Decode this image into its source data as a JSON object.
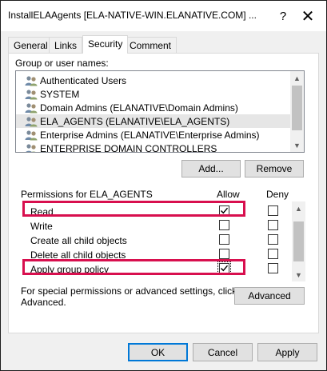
{
  "window": {
    "title": "InstallELAAgents [ELA-NATIVE-WIN.ELANATIVE.COM] ...",
    "help_glyph": "?",
    "close_glyph": "✕"
  },
  "tabs": [
    {
      "label": "General"
    },
    {
      "label": "Links"
    },
    {
      "label": "Security",
      "active": true
    },
    {
      "label": "Comment"
    }
  ],
  "groups": {
    "label": "Group or user names:",
    "items": [
      {
        "name": "Authenticated Users"
      },
      {
        "name": "SYSTEM"
      },
      {
        "name": "Domain Admins (ELANATIVE\\Domain Admins)"
      },
      {
        "name": "ELA_AGENTS (ELANATIVE\\ELA_AGENTS)",
        "selected": true
      },
      {
        "name": "Enterprise Admins (ELANATIVE\\Enterprise Admins)"
      },
      {
        "name": "ENTERPRISE DOMAIN CONTROLLERS"
      }
    ],
    "add_label": "Add...",
    "remove_label": "Remove"
  },
  "permissions": {
    "label": "Permissions for ELA_AGENTS",
    "allow_header": "Allow",
    "deny_header": "Deny",
    "rows": [
      {
        "name": "Read",
        "allow": true,
        "deny": false,
        "highlighted": true
      },
      {
        "name": "Write",
        "allow": false,
        "deny": false
      },
      {
        "name": "Create all child objects",
        "allow": false,
        "deny": false
      },
      {
        "name": "Delete all child objects",
        "allow": false,
        "deny": false
      },
      {
        "name": "Apply group policy",
        "allow": true,
        "deny": false,
        "highlighted": true,
        "focused": true
      }
    ]
  },
  "advanced": {
    "text": "For special permissions or advanced settings, click Advanced.",
    "text_line1": "For special permissions or advanced settings, click",
    "text_line2": "Advanced.",
    "button_label": "Advanced"
  },
  "footer": {
    "ok_label": "OK",
    "cancel_label": "Cancel",
    "apply_label": "Apply"
  },
  "colors": {
    "highlight": "#d80f4e",
    "focus_border": "#0078d7",
    "selection": "#e6e6e6"
  }
}
